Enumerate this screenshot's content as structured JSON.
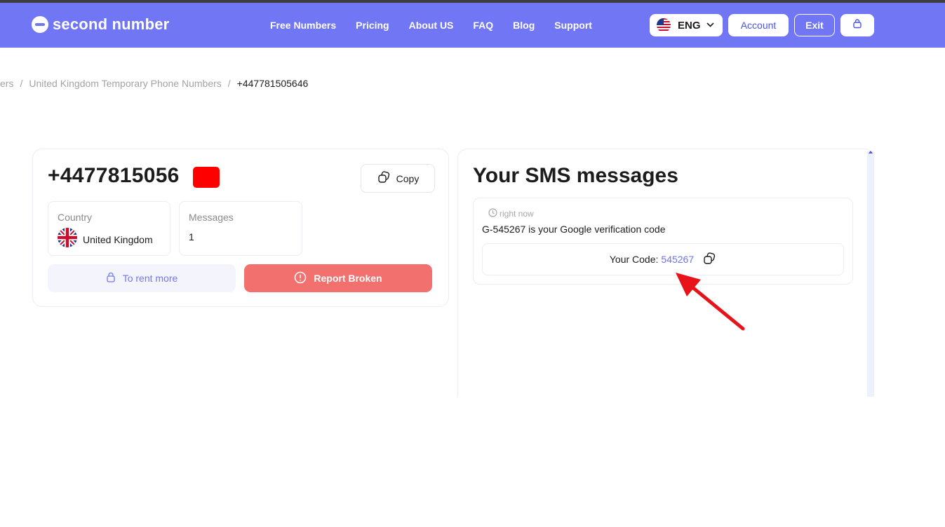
{
  "header": {
    "logo_text": "second number",
    "nav": [
      "Free Numbers",
      "Pricing",
      "About US",
      "FAQ",
      "Blog",
      "Support"
    ],
    "language": "ENG",
    "account_label": "Account",
    "exit_label": "Exit",
    "brand_color": "#7076f4"
  },
  "breadcrumb": {
    "items": [
      "ers",
      "United Kingdom Temporary Phone Numbers",
      "+447781505646"
    ],
    "separator": "/"
  },
  "number_card": {
    "phone_visible": "+4477815056",
    "copy_label": "Copy",
    "country_title": "Country",
    "country_value": "United Kingdom",
    "messages_title": "Messages",
    "messages_value": "1",
    "rent_label": "To rent more",
    "report_label": "Report Broken",
    "report_color": "#f2706e"
  },
  "sms": {
    "title": "Your SMS messages",
    "messages": [
      {
        "time": "right now",
        "text": "G-545267 is your Google verification code",
        "code_label": "Your Code:",
        "code": "545267"
      }
    ]
  },
  "annotation": {
    "arrow_color": "#e8121a"
  },
  "icons": [
    "logo-icon",
    "us-flag-icon",
    "chevron-down-icon",
    "cart-icon",
    "copy-icon",
    "uk-flag-icon",
    "lock-icon",
    "alert-icon",
    "clock-icon",
    "red-arrow-icon"
  ]
}
